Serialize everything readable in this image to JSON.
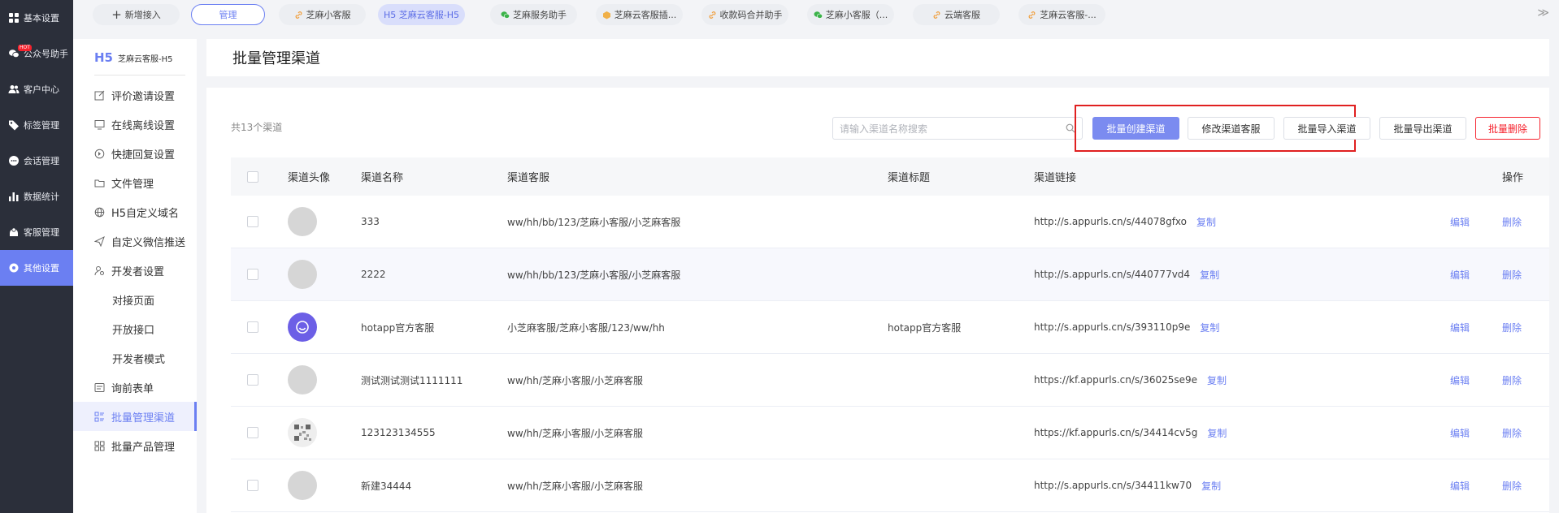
{
  "nav": [
    {
      "label": "基本设置",
      "icon": "grid-icon"
    },
    {
      "label": "公众号助手",
      "icon": "wechat-icon",
      "badge": "HOT"
    },
    {
      "label": "客户中心",
      "icon": "users-icon"
    },
    {
      "label": "标签管理",
      "icon": "tag-icon"
    },
    {
      "label": "会话管理",
      "icon": "chat-icon"
    },
    {
      "label": "数据统计",
      "icon": "bar-chart-icon"
    },
    {
      "label": "客服管理",
      "icon": "service-icon"
    },
    {
      "label": "其他设置",
      "icon": "gear-icon"
    }
  ],
  "tabs": {
    "new_label": "新增接入",
    "manage_label": "管理",
    "items": [
      "芝麻小客服",
      "H5 芝麻云客服-H5",
      "芝麻服务助手",
      "芝麻云客服插...",
      "收款码合并助手",
      "芝麻小客服（...",
      "云端客服",
      "芝麻云客服-..."
    ],
    "more": "≫"
  },
  "subnav": {
    "brand_badge": "H5",
    "brand_title": "芝麻云客服-H5",
    "items": [
      "评价邀请设置",
      "在线离线设置",
      "快捷回复设置",
      "文件管理",
      "H5自定义域名",
      "自定义微信推送",
      "开发者设置",
      "对接页面",
      "开放接口",
      "开发者模式",
      "询前表单",
      "批量管理渠道",
      "批量产品管理"
    ]
  },
  "page": {
    "title": "批量管理渠道",
    "count": "共13个渠道",
    "search_placeholder": "请输入渠道名称搜索",
    "buttons": {
      "batch_create": "批量创建渠道",
      "edit_service": "修改渠道客服",
      "batch_import": "批量导入渠道",
      "batch_export": "批量导出渠道",
      "batch_delete": "批量删除"
    }
  },
  "table": {
    "headers": {
      "avatar": "渠道头像",
      "name": "渠道名称",
      "service": "渠道客服",
      "title": "渠道标题",
      "link": "渠道链接",
      "ops": "操作"
    },
    "copy_label": "复制",
    "edit_label": "编辑",
    "delete_label": "删除",
    "rows": [
      {
        "name": "333",
        "service": "ww/hh/bb/123/芝麻小客服/小芝麻客服",
        "title": "",
        "link": "http://s.appurls.cn/s/44078gfxo"
      },
      {
        "name": "2222",
        "service": "ww/hh/bb/123/芝麻小客服/小芝麻客服",
        "title": "",
        "link": "http://s.appurls.cn/s/440777vd4"
      },
      {
        "name": "hotapp官方客服",
        "service": "小芝麻客服/芝麻小客服/123/ww/hh",
        "title": "hotapp官方客服",
        "link": "http://s.appurls.cn/s/393110p9e"
      },
      {
        "name": "测试测试测试1111111",
        "service": "ww/hh/芝麻小客服/小芝麻客服",
        "title": "",
        "link": "https://kf.appurls.cn/s/36025se9e"
      },
      {
        "name": "123123134555",
        "service": "ww/hh/芝麻小客服/小芝麻客服",
        "title": "",
        "link": "https://kf.appurls.cn/s/34414cv5g"
      },
      {
        "name": "新建34444",
        "service": "ww/hh/芝麻小客服/小芝麻客服",
        "title": "",
        "link": "http://s.appurls.cn/s/34411kw70"
      }
    ]
  },
  "colors": {
    "nav_bg": "#2b2f3a",
    "accent": "#6b7ff2",
    "danger": "#f5222d",
    "highlight_box": "#e02020"
  }
}
